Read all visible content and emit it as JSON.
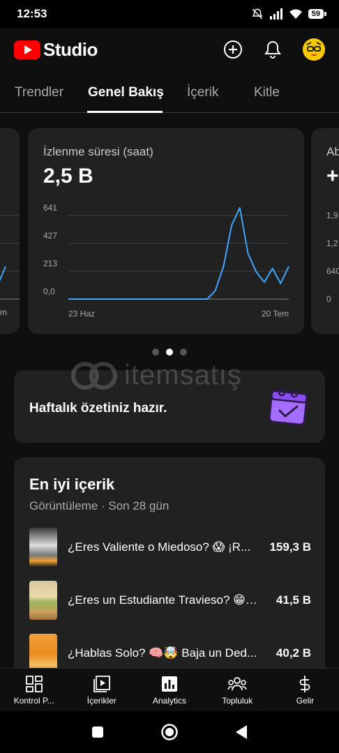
{
  "status_bar": {
    "time": "12:53",
    "battery": "59"
  },
  "header": {
    "logo_text": "Studio"
  },
  "tabs": [
    {
      "label": "Trendler",
      "active": false
    },
    {
      "label": "Genel Bakış",
      "active": true
    },
    {
      "label": "İçerik",
      "active": false
    },
    {
      "label": "Kitle",
      "active": false
    }
  ],
  "left_card": {
    "tick_label_bottom": "m"
  },
  "main_card": {
    "label": "İzlenme süresi (saat)",
    "value": "2,5 B"
  },
  "right_card": {
    "label": "Ab",
    "value": "+",
    "ticks": [
      "1,9",
      "1,2",
      "640",
      "0"
    ]
  },
  "chart_data": {
    "type": "line",
    "title": "",
    "xlabel": "",
    "ylabel": "",
    "y_ticks": [
      "641",
      "427",
      "213",
      "0,0"
    ],
    "x_tick_labels": [
      "23 Haz",
      "20 Tem"
    ],
    "ylim": [
      0,
      641
    ],
    "x": [
      0,
      1,
      2,
      3,
      4,
      5,
      6,
      7,
      8,
      9,
      10,
      11,
      12,
      13,
      14,
      15,
      16,
      17,
      18,
      19,
      20,
      21,
      22,
      23,
      24,
      25,
      26,
      27
    ],
    "values": [
      0,
      0,
      0,
      0,
      0,
      0,
      0,
      0,
      0,
      0,
      0,
      0,
      0,
      0,
      0,
      0,
      0,
      0,
      65,
      250,
      565,
      700,
      350,
      210,
      130,
      235,
      120,
      250
    ],
    "color": "#3ea6ff"
  },
  "pagination": {
    "count": 3,
    "active_index": 1
  },
  "summary": {
    "text": "Haftalık özetiniz hazır."
  },
  "watermark": {
    "text": "itemsatış"
  },
  "top_content": {
    "title": "En iyi içerik",
    "subtitle": "Görüntüleme · Son 28 gün",
    "items": [
      {
        "title": "¿Eres Valiente o Miedoso? 😱 ¡R...",
        "value": "159,3 B"
      },
      {
        "title": "¿Eres un Estudiante Travieso? 😁 ...",
        "value": "41,5 B"
      },
      {
        "title": "¿Hablas Solo? 🧠🤯 Baja un Ded...",
        "value": "40,2 B"
      }
    ]
  },
  "bottom_nav": [
    {
      "label": "Kontrol P...",
      "icon": "dashboard-icon"
    },
    {
      "label": "İçerikler",
      "icon": "content-icon"
    },
    {
      "label": "Analytics",
      "icon": "analytics-icon"
    },
    {
      "label": "Topluluk",
      "icon": "community-icon"
    },
    {
      "label": "Gelir",
      "icon": "earn-icon"
    }
  ]
}
